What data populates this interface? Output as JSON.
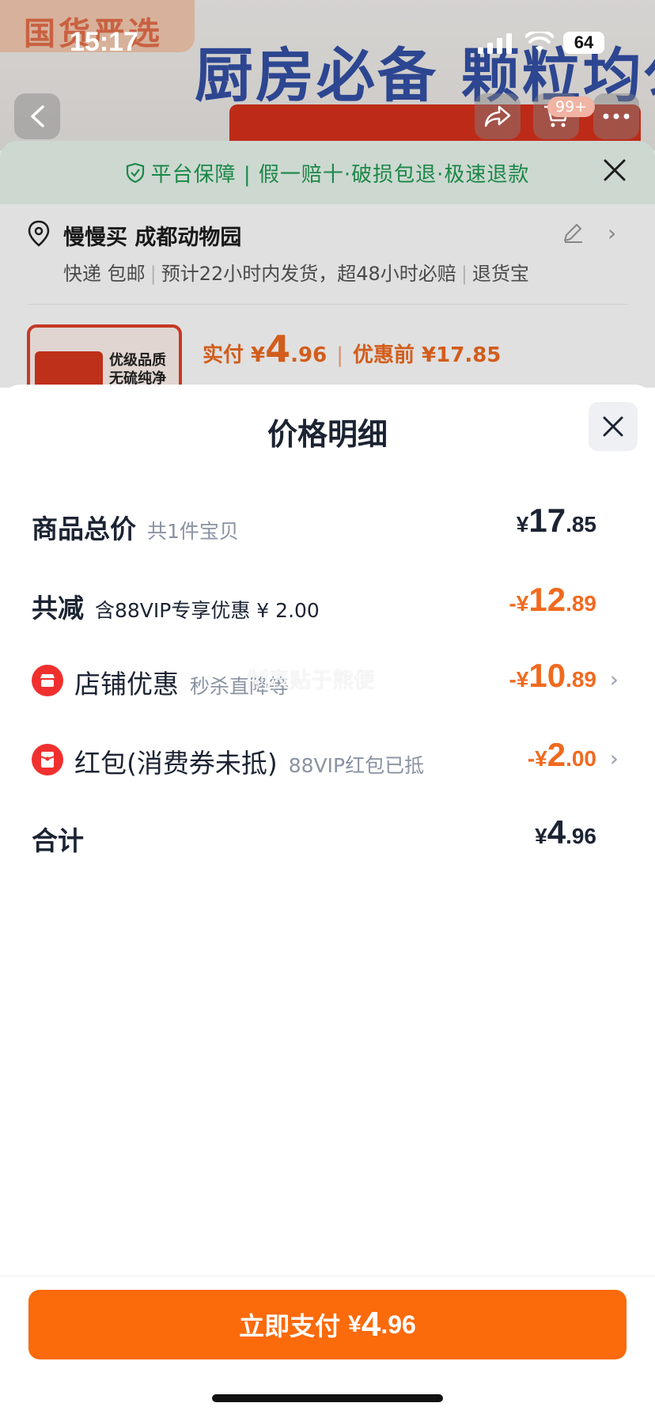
{
  "status_bar": {
    "time": "15:17",
    "battery": "64"
  },
  "background": {
    "brand_badge": "国货严选",
    "headline": "厨房必备 颗粒均匀",
    "cart_count": "99+",
    "guarantee": "平台保障 | 假一赔十·破损包退·极速退款",
    "address_name": "慢慢买 成都动物园",
    "shipping": [
      "快递 包邮",
      "预计22小时内发货，超48小时必赔",
      "退货宝"
    ],
    "product_thumb_text": [
      "优级品质",
      "无硫纯净"
    ],
    "pay_label": "实付 ¥",
    "pay_int": "4",
    "pay_dec": ".96",
    "pre_discount": "优惠前 ¥17.85"
  },
  "modal": {
    "title": "价格明细",
    "rows": [
      {
        "label": "商品总价",
        "sub": "共1件宝贝",
        "yen": "¥",
        "int": "17",
        "dec": ".85"
      },
      {
        "label": "共减",
        "sub": "含88VIP专享优惠 ¥ 2.00",
        "yen": "-¥",
        "int": "12",
        "dec": ".89"
      },
      {
        "label": "店铺优惠",
        "sub": "秒杀直降等",
        "yen": "-¥",
        "int": "10",
        "dec": ".89"
      },
      {
        "label": "红包(消费券未抵)",
        "sub": "88VIP红包已抵",
        "yen": "-¥",
        "int": "2",
        "dec": ".00"
      },
      {
        "label": "合计",
        "sub": "",
        "yen": "¥",
        "int": "4",
        "dec": ".96"
      }
    ],
    "watermark": "制表贴于熊便"
  },
  "footer": {
    "pay_label": "立即支付",
    "yen": "¥",
    "int": "4",
    "dec": ".96"
  },
  "colors": {
    "accent": "#fb6a0b",
    "discount": "#f06a1f",
    "guarantee_green": "#1f9b51",
    "icon_red": "#f0302f"
  },
  "icons": [
    "back-icon",
    "share-icon",
    "cart-icon",
    "more-icon",
    "shield-icon",
    "close-icon",
    "location-icon",
    "edit-icon",
    "shop-icon",
    "red-packet-icon",
    "chevron-right-icon"
  ]
}
